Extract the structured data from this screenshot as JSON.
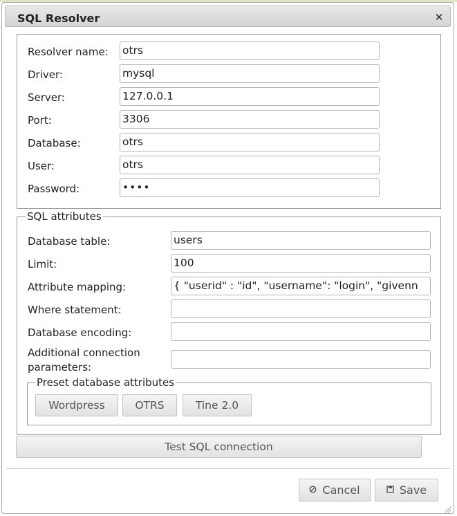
{
  "dialog": {
    "title": "SQL Resolver",
    "close_icon": "close-icon"
  },
  "resolver": {
    "name_label": "Resolver name:",
    "name_value": "otrs",
    "driver_label": "Driver:",
    "driver_value": "mysql",
    "server_label": "Server:",
    "server_value": "127.0.0.1",
    "port_label": "Port:",
    "port_value": "3306",
    "database_label": "Database:",
    "database_value": "otrs",
    "user_label": "User:",
    "user_value": "otrs",
    "password_label": "Password:",
    "password_value": "••••"
  },
  "sql_attributes": {
    "legend": "SQL attributes",
    "table_label": "Database table:",
    "table_value": "users",
    "limit_label": "Limit:",
    "limit_value": "100",
    "mapping_label": "Attribute mapping:",
    "mapping_value": "{ \"userid\" : \"id\", \"username\": \"login\", \"givenn",
    "where_label": "Where statement:",
    "where_value": "",
    "encoding_label": "Database encoding:",
    "encoding_value": "",
    "additional_label_line1": "Additional connection",
    "additional_label_line2": "parameters:",
    "additional_value": ""
  },
  "presets": {
    "legend": "Preset database attributes",
    "buttons": [
      "Wordpress",
      "OTRS",
      "Tine 2.0"
    ]
  },
  "test_button": "Test SQL connection",
  "footer": {
    "cancel_label": "Cancel",
    "cancel_icon": "cancel-icon",
    "save_label": "Save",
    "save_icon": "save-icon"
  }
}
